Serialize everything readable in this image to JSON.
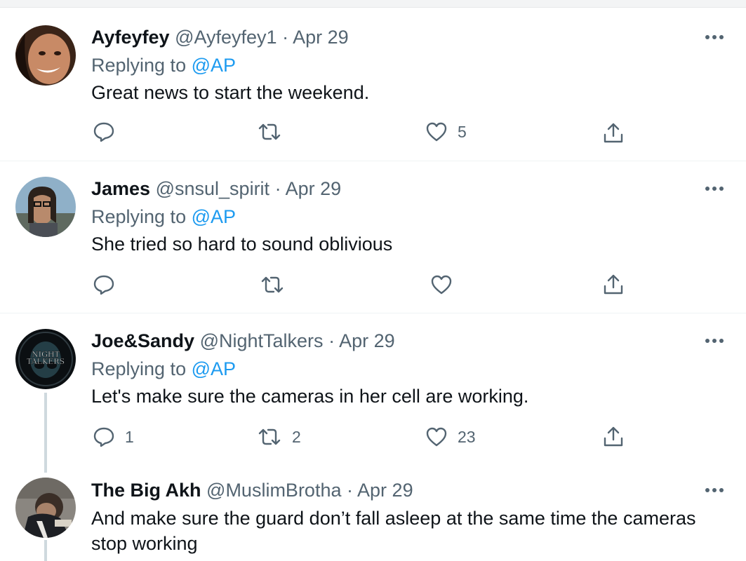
{
  "tweets": [
    {
      "name": "Ayfeyfey",
      "handle": "@Ayfeyfey1",
      "sep": "·",
      "date": "Apr 29",
      "replying_prefix": "Replying to",
      "replying_handle": "@AP",
      "text": "Great news to start the weekend.",
      "replies": "",
      "retweets": "",
      "likes": "5"
    },
    {
      "name": "James",
      "handle": "@snsul_spirit",
      "sep": "·",
      "date": "Apr 29",
      "replying_prefix": "Replying to",
      "replying_handle": "@AP",
      "text": "She tried so hard to sound oblivious",
      "replies": "",
      "retweets": "",
      "likes": ""
    },
    {
      "name": "Joe&Sandy",
      "handle": "@NightTalkers",
      "sep": "·",
      "date": "Apr 29",
      "replying_prefix": "Replying to",
      "replying_handle": "@AP",
      "text": "Let's make sure the cameras in her cell are working.",
      "replies": "1",
      "retweets": "2",
      "likes": "23",
      "avatar_text_1": "NIGHT",
      "avatar_text_2": "TALKERS"
    },
    {
      "name": "The Big Akh",
      "handle": "@MuslimBrotha",
      "sep": "·",
      "date": "Apr 29",
      "text_line1": "And make sure the guard don’t fall asleep at the same time the cameras",
      "text_line2": "stop working"
    }
  ],
  "colors": {
    "text": "#0f1419",
    "secondary": "#536471",
    "link": "#1d9bf0",
    "divider": "#eff3f4",
    "thread_line": "#cfd9de"
  },
  "icons": [
    "reply-icon",
    "retweet-icon",
    "like-icon",
    "share-icon",
    "more-icon"
  ]
}
